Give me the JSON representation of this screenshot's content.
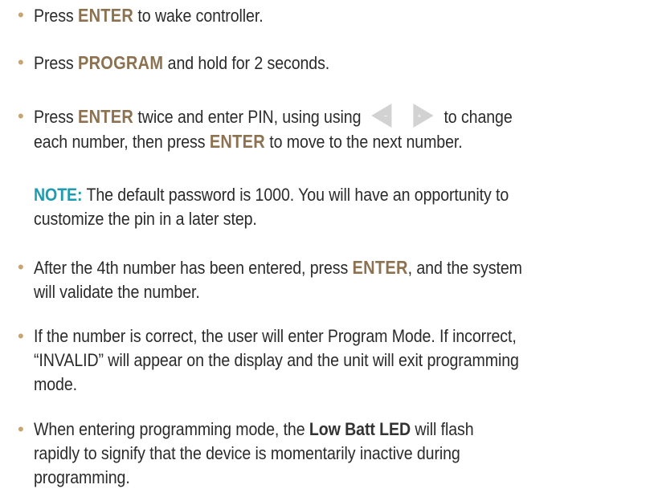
{
  "steps": [
    {
      "pre": "Press ",
      "kw": "ENTER",
      "post": "  to wake controller."
    },
    {
      "pre": "Press ",
      "kw": "PROGRAM",
      "post": "  and hold for 2 seconds."
    },
    {
      "pre": "Press ",
      "kw": "ENTER",
      "mid": "  twice and enter PIN, using using",
      "minus_symbol": "−",
      "plus_symbol": "+",
      "mid2": "to change",
      "line2_pre": "each number, then press ",
      "kw2": "ENTER",
      "line2_post": " to move to the next number."
    }
  ],
  "note": {
    "label": "NOTE:",
    "line1": "  The default password is 1000. You will have an opportunity to",
    "line2": "customize the pin in a later step."
  },
  "steps2": [
    {
      "pre": "After the 4th number has been entered, press ",
      "kw": "ENTER",
      "post": ", and the system",
      "line2": "will validate the number."
    },
    {
      "line1": "If the number is correct, the user will enter  Program Mode.  If incorrect,",
      "line2": "“INVALID” will appear on the display and the unit will exit programming",
      "line3": "mode."
    },
    {
      "pre": "When entering programming mode, the ",
      "kw": "Low Batt LED",
      "post": " will flash",
      "line2": "rapidly to signify that the device is momentarily inactive during",
      "line3": "programming."
    }
  ],
  "colors": {
    "bullet": "#c7a56e",
    "keyword": "#8c7250",
    "note": "#1e9bb0",
    "arrow_button": "#d2d2d2"
  },
  "icons": [
    "left-arrow-minus-icon",
    "right-arrow-plus-icon"
  ]
}
